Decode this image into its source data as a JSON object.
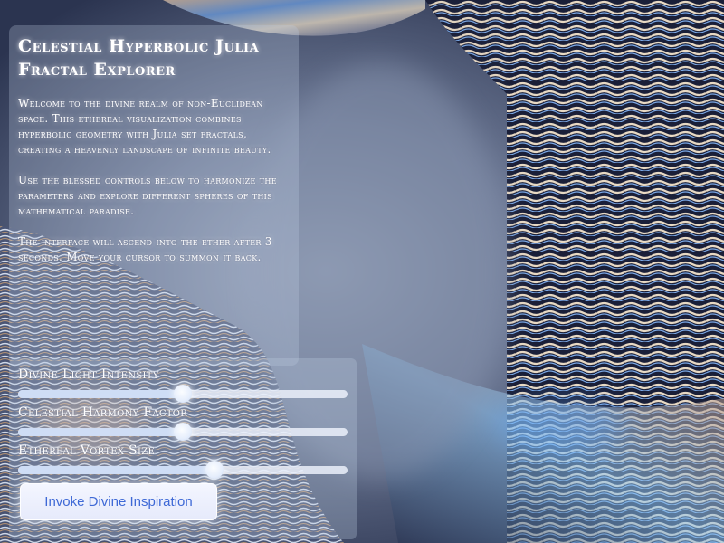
{
  "info": {
    "title": "Celestial Hyperbolic Julia Fractal Explorer",
    "paragraphs": [
      "Welcome to the divine realm of non-Euclidean space. This ethereal visualization combines hyperbolic geometry with Julia set fractals, creating a heavenly landscape of infinite beauty.",
      "Use the blessed controls below to harmonize the parameters and explore different spheres of this mathematical paradise.",
      "The interface will ascend into the ether after 3 seconds. Move your cursor to summon it back."
    ]
  },
  "controls": {
    "sliders": [
      {
        "label": "Divine Light Intensity",
        "value": 0.5
      },
      {
        "label": "Celestial Harmony Factor",
        "value": 0.5
      },
      {
        "label": "Ethereal Vortex Size",
        "value": 0.597
      }
    ],
    "button_label": "Invoke Divine Inspiration"
  },
  "colors": {
    "button_text": "#3e69d6",
    "panel_tint": "#becde1"
  }
}
